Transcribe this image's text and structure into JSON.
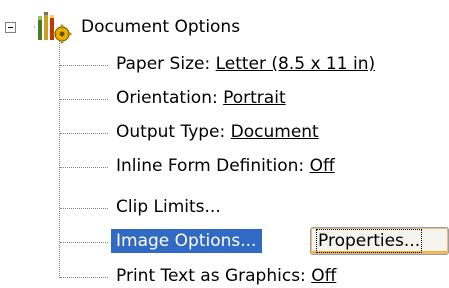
{
  "tree": {
    "root": {
      "label": "Document Options",
      "icon": "document-options-icon",
      "expanded": true
    },
    "items": [
      {
        "name": "Paper Size: ",
        "value": "Letter (8.5 x 11 in)"
      },
      {
        "name": "Orientation: ",
        "value": "Portrait"
      },
      {
        "name": "Output Type: ",
        "value": "Document"
      },
      {
        "name": "Inline Form Definition: ",
        "value": "Off"
      },
      {
        "name": "Clip Limits...",
        "value": ""
      },
      {
        "name": "Image Options...",
        "value": "",
        "selected": true
      },
      {
        "name": "Print Text as Graphics: ",
        "value": "Off"
      }
    ],
    "properties_button": "Properties..."
  },
  "colors": {
    "selection": "#316ac5",
    "tree_lines": "#808080"
  }
}
